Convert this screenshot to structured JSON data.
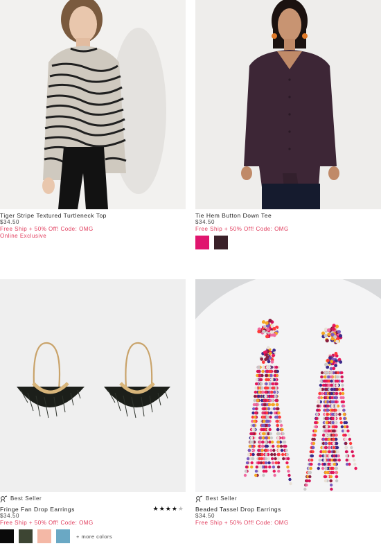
{
  "products": [
    {
      "name": "Tiger Stripe Textured Turtleneck Top",
      "price": "$34.50",
      "promo": "Free Ship + 50% Off! Code: OMG",
      "tag": "Online Exclusive"
    },
    {
      "name": "Tie Hem Button Down Tee",
      "price": "$34.50",
      "promo": "Free Ship + 50% Off! Code: OMG",
      "swatches": [
        "#e0156e",
        "#3a2129"
      ]
    },
    {
      "badge": "Best Seller",
      "name": "Fringe Fan Drop Earrings",
      "price": "$34.50",
      "promo": "Free Ship + 50% Off! Code: OMG",
      "rating": 4,
      "rating_max": 5,
      "swatches": [
        "#0a0a0a",
        "#3d4533",
        "#f4b8a6",
        "#6aa8c4"
      ],
      "more_colors": "+ more colors"
    },
    {
      "badge": "Best Seller",
      "name": "Beaded Tassel Drop Earrings",
      "price": "$34.50",
      "promo": "Free Ship + 50% Off! Code: OMG"
    }
  ]
}
